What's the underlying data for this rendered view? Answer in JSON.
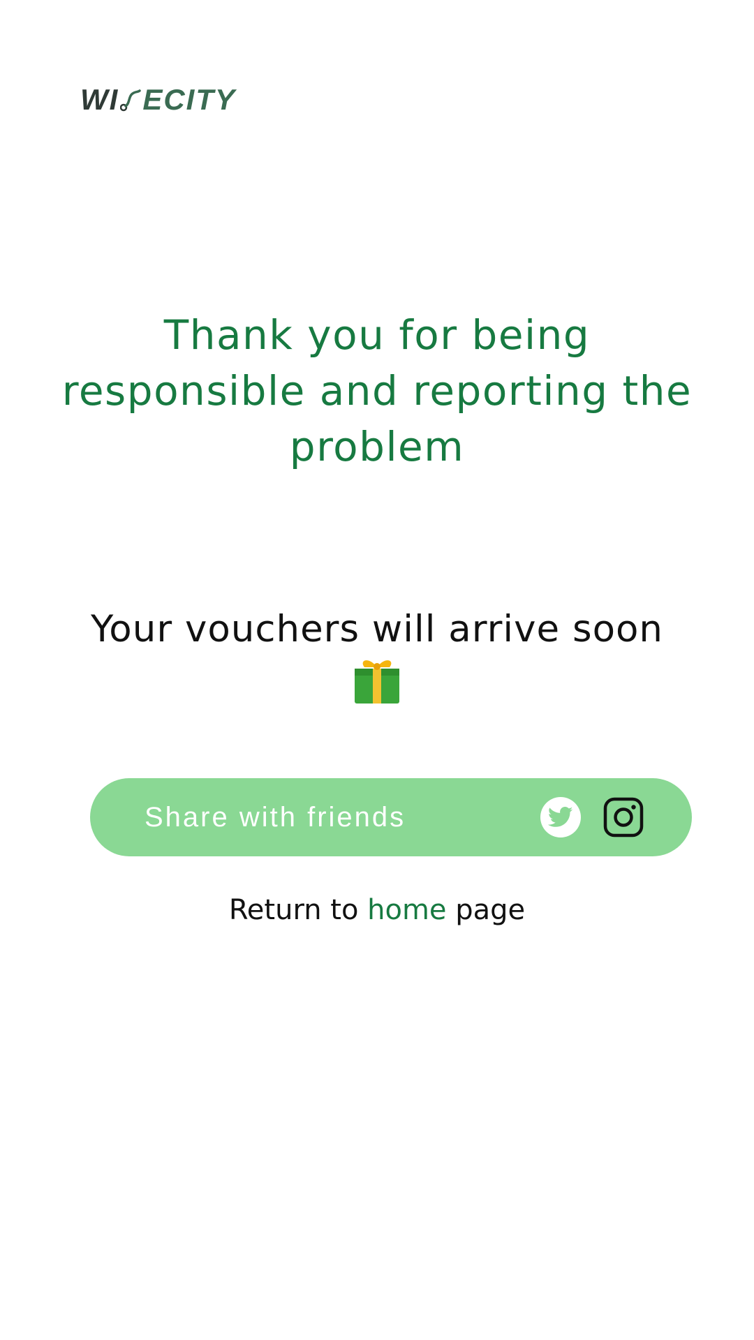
{
  "brand": {
    "part1": "WI",
    "part2": "ECITY",
    "colors": {
      "dark": "#2f3a36",
      "mid": "#3a6b52",
      "light": "#5fbf8c"
    }
  },
  "thanks_message": "Thank you for being responsible and reporting the problem",
  "vouchers_message": "Your vouchers will arrive soon",
  "gift_icon": "gift-icon",
  "share": {
    "label": "Share with friends",
    "icons": [
      "twitter-icon",
      "instagram-icon"
    ],
    "background": "#8ad894"
  },
  "return_link": {
    "prefix": "Return to",
    "link_text": "home",
    "suffix": "page"
  },
  "accent_color": "#177a41"
}
